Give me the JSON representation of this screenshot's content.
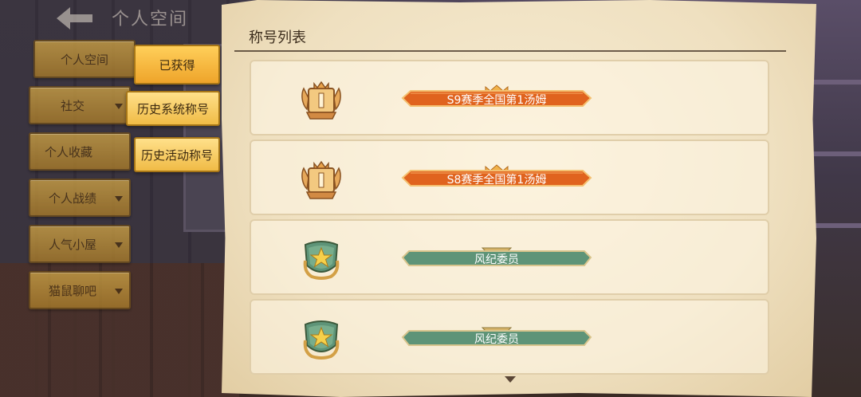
{
  "header": {
    "title": "个人空间",
    "back_icon": "back-arrow-icon"
  },
  "nav": {
    "items": [
      {
        "label": "个人空间",
        "has_caret": false
      },
      {
        "label": "社交",
        "has_caret": true
      },
      {
        "label": "个人收藏",
        "has_caret": false
      },
      {
        "label": "个人战绩",
        "has_caret": true
      },
      {
        "label": "人气小屋",
        "has_caret": true
      },
      {
        "label": "猫鼠聊吧",
        "has_caret": true
      }
    ],
    "sub_items": [
      {
        "label": "已获得",
        "active": true
      },
      {
        "label": "历史系统称号",
        "active": false
      },
      {
        "label": "历史活动称号",
        "active": false
      }
    ]
  },
  "panel": {
    "title": "称号列表",
    "titles": [
      {
        "label": "S9赛季全国第1汤姆",
        "style": "orange",
        "icon": "rank-1-badge-icon"
      },
      {
        "label": "S8赛季全国第1汤姆",
        "style": "orange",
        "icon": "rank-1-badge-icon"
      },
      {
        "label": "风纪委员",
        "style": "green",
        "icon": "star-shield-icon"
      },
      {
        "label": "风纪委员",
        "style": "green",
        "icon": "star-shield-icon"
      }
    ]
  },
  "colors": {
    "tag_orange": "#e0631e",
    "tag_green": "#5e9478",
    "parchment": "#f2e4c6",
    "nav_gold": "#c79a40"
  }
}
